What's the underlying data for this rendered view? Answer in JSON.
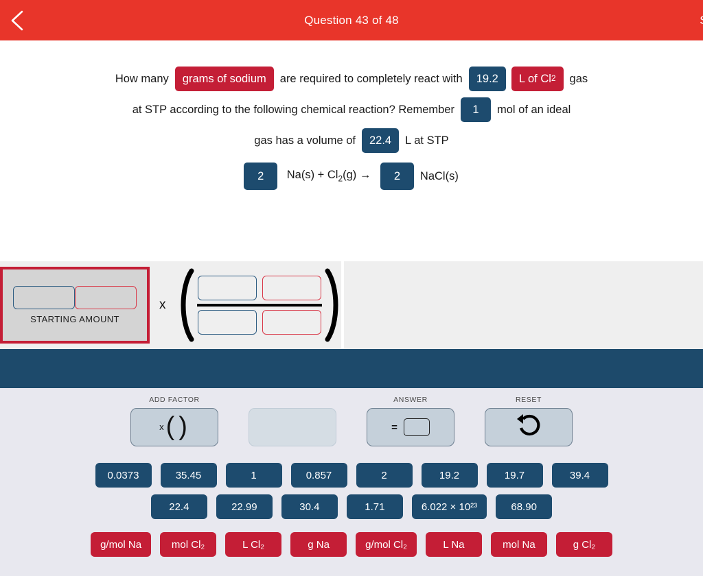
{
  "header": {
    "back_icon": "chevron-left-icon",
    "title": "Question 43 of 48",
    "submit_label": "Su",
    "color": "#e8352a"
  },
  "question": {
    "line1": [
      {
        "type": "text",
        "value": "How many"
      },
      {
        "type": "chip",
        "style": "red",
        "value": "grams of sodium"
      },
      {
        "type": "text",
        "value": "are required to completely react with"
      },
      {
        "type": "chip",
        "style": "blue",
        "value": "19.2"
      },
      {
        "type": "chip",
        "style": "red",
        "value": "L of Cl₂"
      },
      {
        "type": "text",
        "value": "gas"
      }
    ],
    "line2": [
      {
        "type": "text",
        "value": "at STP according to the following chemical reaction? Remember"
      },
      {
        "type": "chip",
        "style": "blue",
        "value": "1"
      },
      {
        "type": "text",
        "value": "mol of an ideal"
      }
    ],
    "line3": [
      {
        "type": "text",
        "value": "gas has a volume of"
      },
      {
        "type": "chip",
        "style": "blue",
        "value": "22.4"
      },
      {
        "type": "text",
        "value": "L at STP"
      }
    ],
    "equation": {
      "coefficient_left": "2",
      "reactants": "Na(s) + Cl₂(g) →",
      "coefficient_right": "2",
      "product": "NaCl(s)"
    },
    "text_parts": {
      "how_many": "How many",
      "grams_of_sodium": "grams of sodium",
      "are_required": "are required to completely react with",
      "value_192": "19.2",
      "l_of_cl2": "L of Cl₂",
      "gas": "gas",
      "at_stp": "at STP according to the following chemical reaction? Remember",
      "value_1": "1",
      "mol_of_ideal": "mol of an ideal",
      "gas_has_volume": "gas has a volume of",
      "value_224": "22.4",
      "l_at_stp": "L at STP"
    }
  },
  "work_area": {
    "starting_amount_label": "STARTING AMOUNT",
    "multiply_sign": "x",
    "starting_slots": [
      {
        "style": "blue",
        "value": ""
      },
      {
        "style": "red",
        "value": ""
      }
    ],
    "numerator_slots": [
      {
        "style": "blue",
        "value": ""
      },
      {
        "style": "red",
        "value": ""
      }
    ],
    "denominator_slots": [
      {
        "style": "blue",
        "value": ""
      },
      {
        "style": "red",
        "value": ""
      }
    ]
  },
  "controls": {
    "add_factor": {
      "label": "ADD FACTOR",
      "symbol": "x",
      "paren_open": "(",
      "paren_close": ")"
    },
    "spare": {
      "label": "",
      "value": ""
    },
    "answer": {
      "label": "ANSWER",
      "equals": "=",
      "value": ""
    },
    "reset": {
      "label": "RESET",
      "icon": "undo-arrow-icon"
    }
  },
  "tiles": {
    "numbers_row1": [
      "0.0373",
      "35.45",
      "1",
      "0.857",
      "2",
      "19.2",
      "19.7",
      "39.4"
    ],
    "numbers_row2": [
      "22.4",
      "22.99",
      "30.4",
      "1.71",
      "6.022 × 10²³",
      "68.90"
    ],
    "units_row": [
      "g/mol Na",
      "mol Cl₂",
      "L Cl₂",
      "g Na",
      "g/mol Cl₂",
      "L Na",
      "mol Na",
      "g Cl₂"
    ]
  },
  "colors": {
    "header_red": "#e8352a",
    "tile_blue": "#1d4b6e",
    "tile_red": "#c41e36",
    "band_blue": "#1d4a6b",
    "panel_bg": "#e8e8ef",
    "work_bg": "#efefef"
  }
}
